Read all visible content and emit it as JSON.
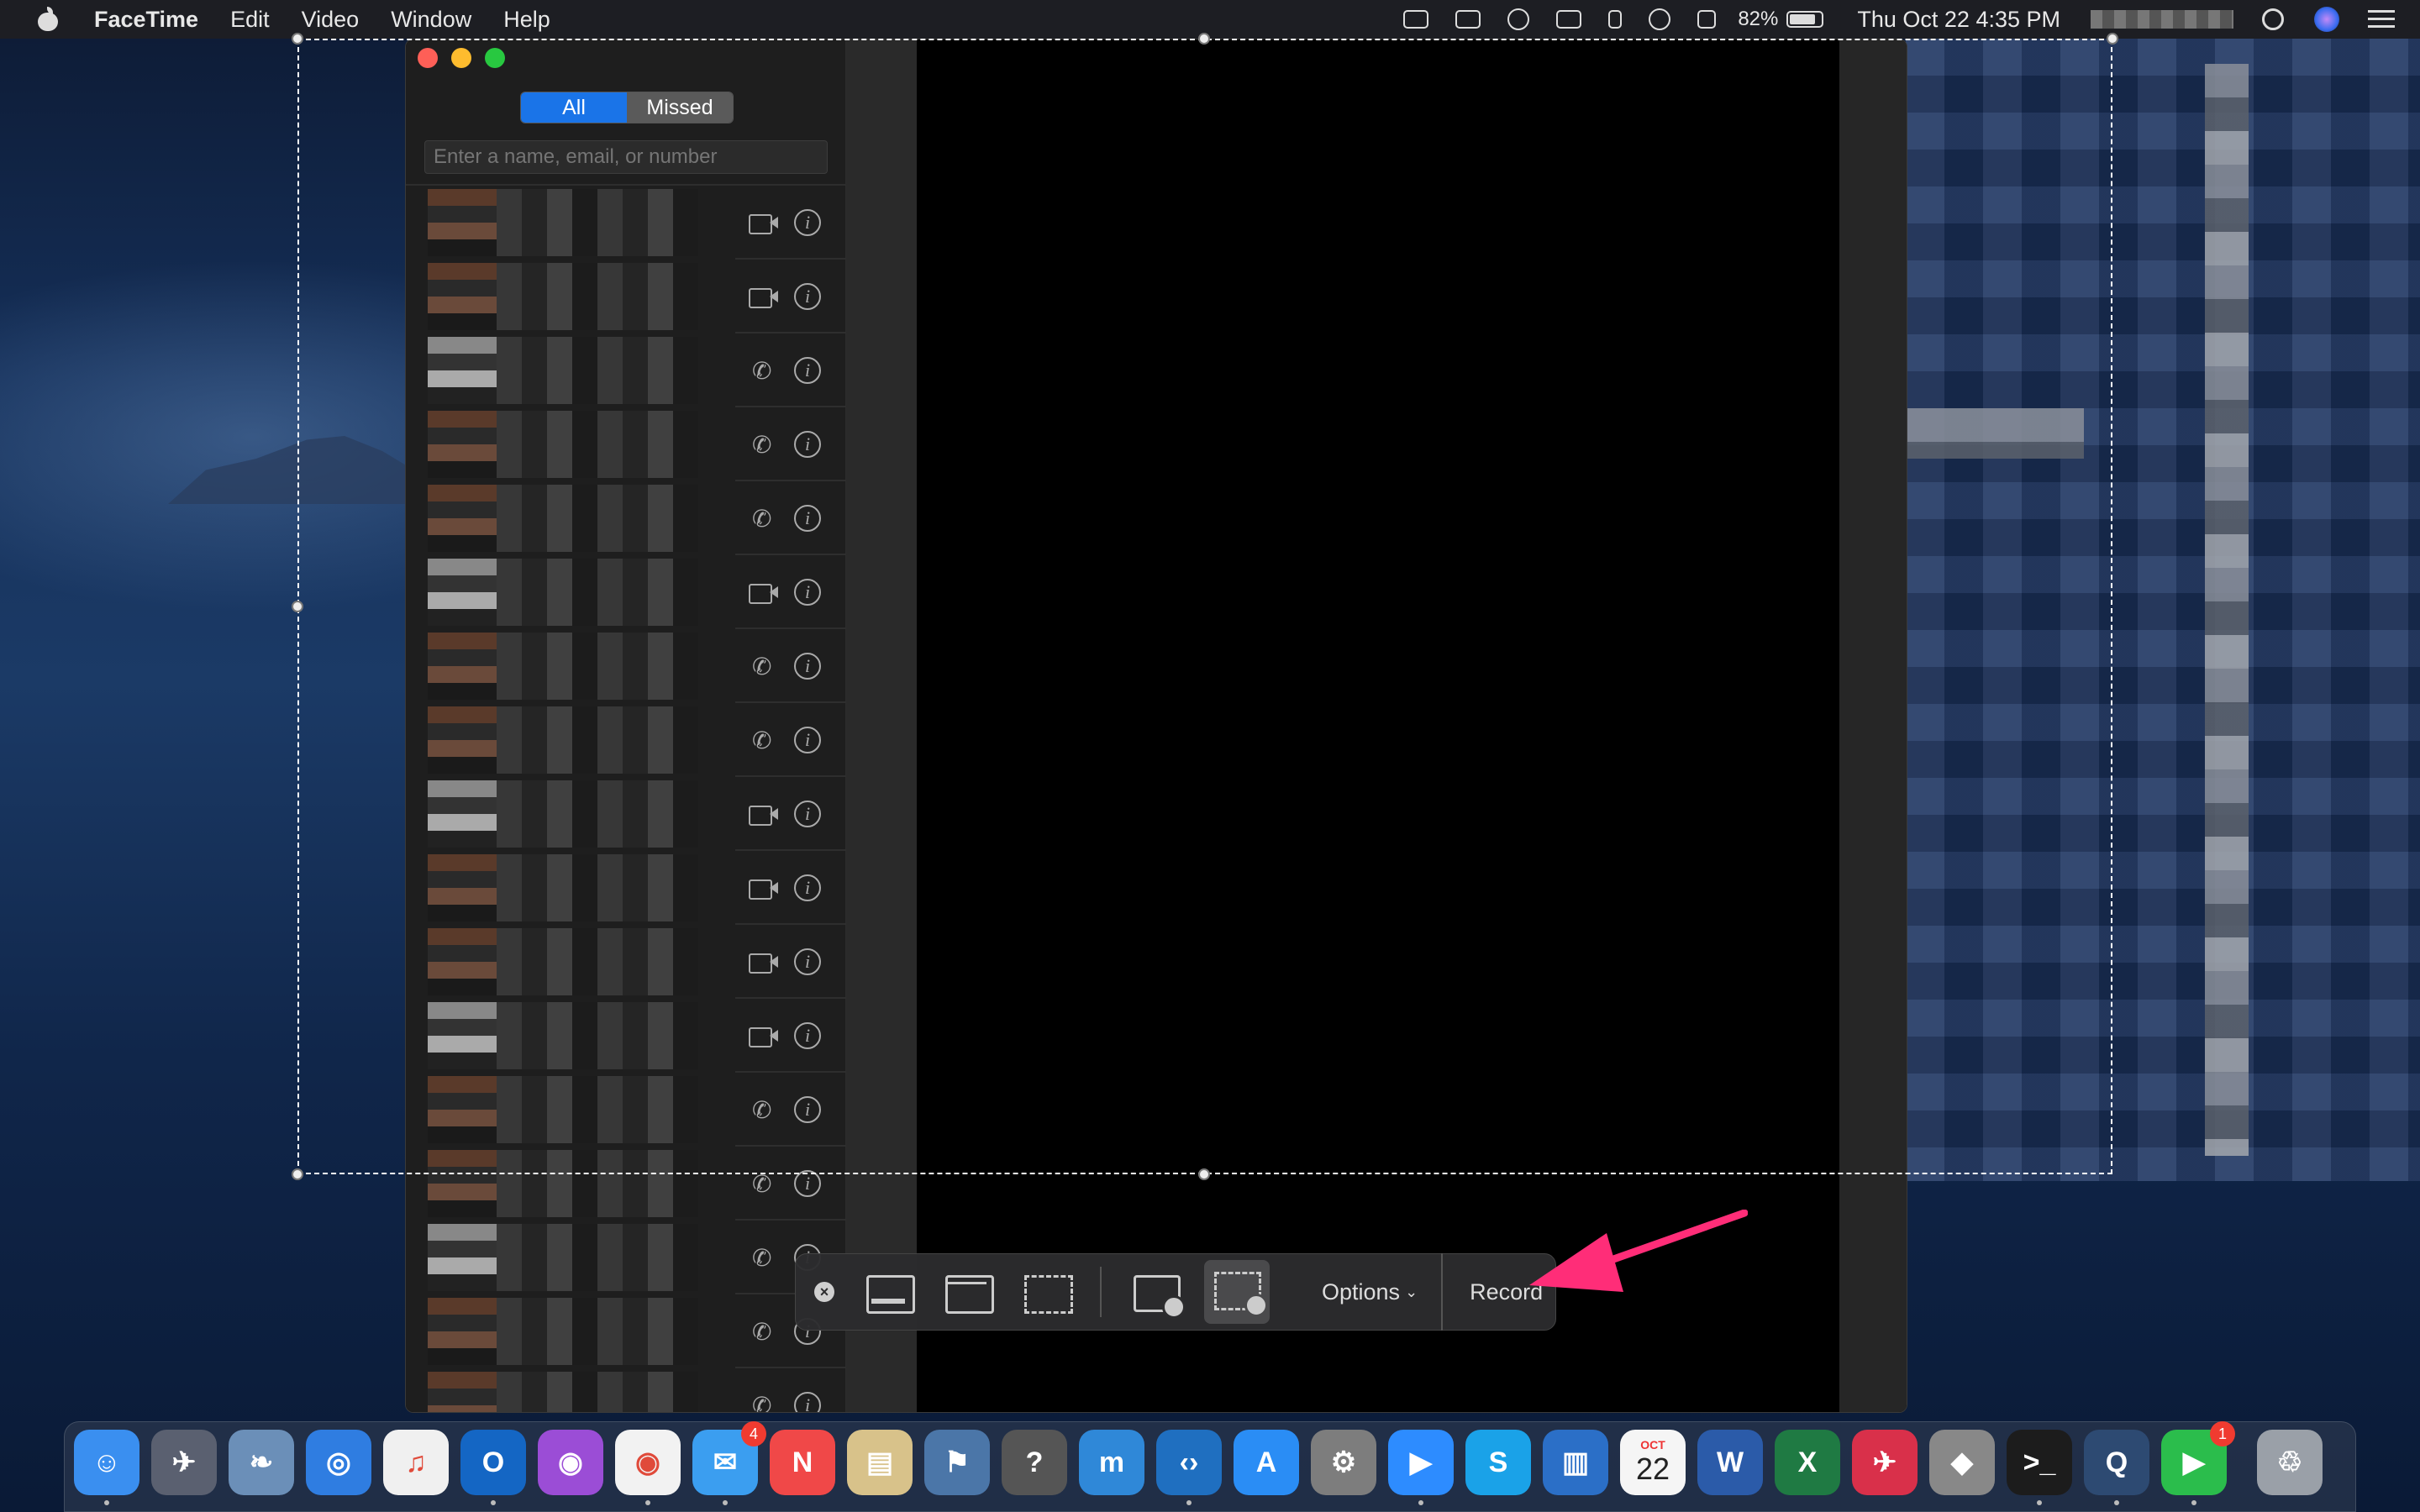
{
  "menubar": {
    "app_name": "FaceTime",
    "menus": [
      "Edit",
      "Video",
      "Window",
      "Help"
    ],
    "battery": "82%",
    "datetime": "Thu Oct 22  4:35 PM"
  },
  "facetime": {
    "segments": {
      "all": "All",
      "missed": "Missed"
    },
    "search_placeholder": "Enter a name, email, or number",
    "calls": [
      {
        "type": "video"
      },
      {
        "type": "video"
      },
      {
        "type": "audio"
      },
      {
        "type": "audio"
      },
      {
        "type": "audio"
      },
      {
        "type": "video"
      },
      {
        "type": "audio"
      },
      {
        "type": "audio"
      },
      {
        "type": "video"
      },
      {
        "type": "video"
      },
      {
        "type": "video"
      },
      {
        "type": "video"
      },
      {
        "type": "audio"
      },
      {
        "type": "audio"
      },
      {
        "type": "audio"
      },
      {
        "type": "audio"
      },
      {
        "type": "audio"
      }
    ]
  },
  "screenshot_toolbar": {
    "options_label": "Options",
    "record_label": "Record",
    "selected_mode": "record-selected-portion"
  },
  "annotation": {
    "arrow_color": "#ff2d78"
  },
  "dock": {
    "items": [
      {
        "name": "Finder",
        "icon": "finder-icon",
        "color": "#3a8ff0"
      },
      {
        "name": "Launchpad",
        "icon": "launchpad-icon",
        "color": "#5a6070"
      },
      {
        "name": "Mail Sender",
        "icon": "eagle-icon",
        "color": "#6b8fb8"
      },
      {
        "name": "Safari",
        "icon": "safari-icon",
        "color": "#2f7de1"
      },
      {
        "name": "Music",
        "icon": "music-icon",
        "color": "#f0f0f0"
      },
      {
        "name": "Outlook",
        "icon": "outlook-icon",
        "color": "#1466c4"
      },
      {
        "name": "Podcasts",
        "icon": "podcasts-icon",
        "color": "#9b4dd6"
      },
      {
        "name": "Chrome",
        "icon": "chrome-icon",
        "color": "#f2f2f2"
      },
      {
        "name": "Messages",
        "icon": "messages-icon",
        "color": "#3b9ef0",
        "badge": "4"
      },
      {
        "name": "News",
        "icon": "news-icon",
        "color": "#f04848"
      },
      {
        "name": "Preview",
        "icon": "preview-icon",
        "color": "#d8c28a"
      },
      {
        "name": "Python",
        "icon": "python-icon",
        "color": "#4b76a8"
      },
      {
        "name": "Help",
        "icon": "help-icon",
        "color": "#555"
      },
      {
        "name": "MuseScore",
        "icon": "musescore-icon",
        "color": "#2f88d8"
      },
      {
        "name": "VS Code",
        "icon": "vscode-icon",
        "color": "#1f6fc0"
      },
      {
        "name": "App Store",
        "icon": "appstore-icon",
        "color": "#2a8df5"
      },
      {
        "name": "System Preferences",
        "icon": "gear-icon",
        "color": "#7d7d7d"
      },
      {
        "name": "Zoom",
        "icon": "zoom-icon",
        "color": "#2d8cff"
      },
      {
        "name": "Skype",
        "icon": "skype-icon",
        "color": "#1aa2e8"
      },
      {
        "name": "Trello",
        "icon": "trello-icon",
        "color": "#2b6fc7"
      },
      {
        "name": "Calendar",
        "icon": "calendar-icon",
        "color": "#f5f5f5",
        "month": "OCT",
        "day": "22"
      },
      {
        "name": "Word",
        "icon": "word-icon",
        "color": "#2b5ba9"
      },
      {
        "name": "Excel",
        "icon": "excel-icon",
        "color": "#1f7a43"
      },
      {
        "name": "Airmail",
        "icon": "airmail-icon",
        "color": "#d9304a"
      },
      {
        "name": "Roblox",
        "icon": "roblox-icon",
        "color": "#888"
      },
      {
        "name": "Terminal",
        "icon": "terminal-icon",
        "color": "#1c1c1c"
      },
      {
        "name": "QuickTime",
        "icon": "quicktime-icon",
        "color": "#2d4a72"
      },
      {
        "name": "FaceTime",
        "icon": "facetime-icon",
        "color": "#2bbd4c",
        "badge": "1"
      },
      {
        "name": "Trash",
        "icon": "trash-icon",
        "color": "#9aa0a8"
      }
    ]
  }
}
